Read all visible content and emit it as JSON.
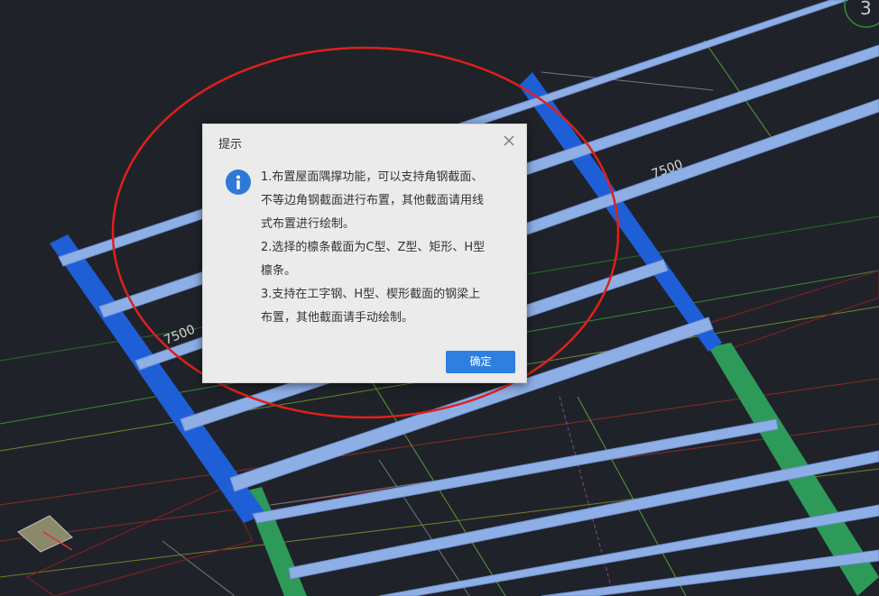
{
  "viewport": {
    "dimension_labels": [
      "7500",
      "7500"
    ],
    "grid_bubble_label": "3"
  },
  "dialog": {
    "title": "提示",
    "close_icon": "close-icon",
    "info_icon": "info-icon",
    "messages": [
      "1.布置屋面隅撑功能，可以支持角钢截面、\n不等边角钢截面进行布置，其他截面请用线\n式布置进行绘制。",
      "2.选择的檩条截面为C型、Z型、矩形、H型\n檩条。",
      "3.支持在工字钢、H型、楔形截面的钢梁上\n布置，其他截面请手动绘制。"
    ],
    "ok_label": "确定"
  },
  "colors": {
    "background": "#1f2329",
    "purlin": "#8eaee6",
    "main_beam": "#1e5fd8",
    "column_beam": "#2d9a5a",
    "annotation_ellipse": "#e0201a",
    "button": "#2e7fe0"
  }
}
